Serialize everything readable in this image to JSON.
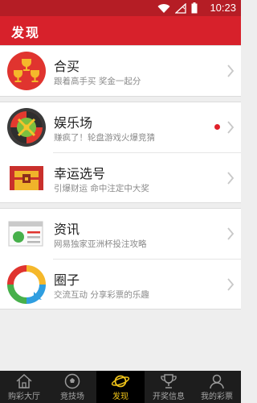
{
  "status_bar": {
    "time": "10:23",
    "icons": [
      "wifi-icon",
      "no-sim-icon",
      "battery-icon"
    ]
  },
  "header": {
    "title": "发现"
  },
  "items": [
    {
      "name": "合买",
      "desc": "跟着高手买 奖金一起分",
      "icon": "trophies-icon",
      "badge": false
    },
    {
      "name": "娱乐场",
      "desc": "赚疯了！轮盘游戏火爆竞猜",
      "icon": "roulette-icon",
      "badge": true
    },
    {
      "name": "幸运选号",
      "desc": "引爆财运 命中注定中大奖",
      "icon": "treasure-chest-icon",
      "badge": false
    },
    {
      "name": "资讯",
      "desc": "网易独家亚洲杯投注攻略",
      "icon": "news-icon",
      "badge": false
    },
    {
      "name": "圈子",
      "desc": "交流互动 分享彩票的乐趣",
      "icon": "chat-circle-icon",
      "badge": false
    }
  ],
  "tabs": [
    {
      "label": "购彩大厅",
      "icon": "home-icon",
      "active": false
    },
    {
      "label": "竞技场",
      "icon": "soccer-ball-icon",
      "active": false
    },
    {
      "label": "发现",
      "icon": "planet-icon",
      "active": true
    },
    {
      "label": "开奖信息",
      "icon": "trophy-cup-icon",
      "active": false
    },
    {
      "label": "我的彩票",
      "icon": "user-icon",
      "active": false
    }
  ],
  "colors": {
    "brand_red": "#d7212b",
    "status_red": "#b51d25",
    "tab_active": "#f0c419",
    "badge_red": "#e0202a"
  }
}
